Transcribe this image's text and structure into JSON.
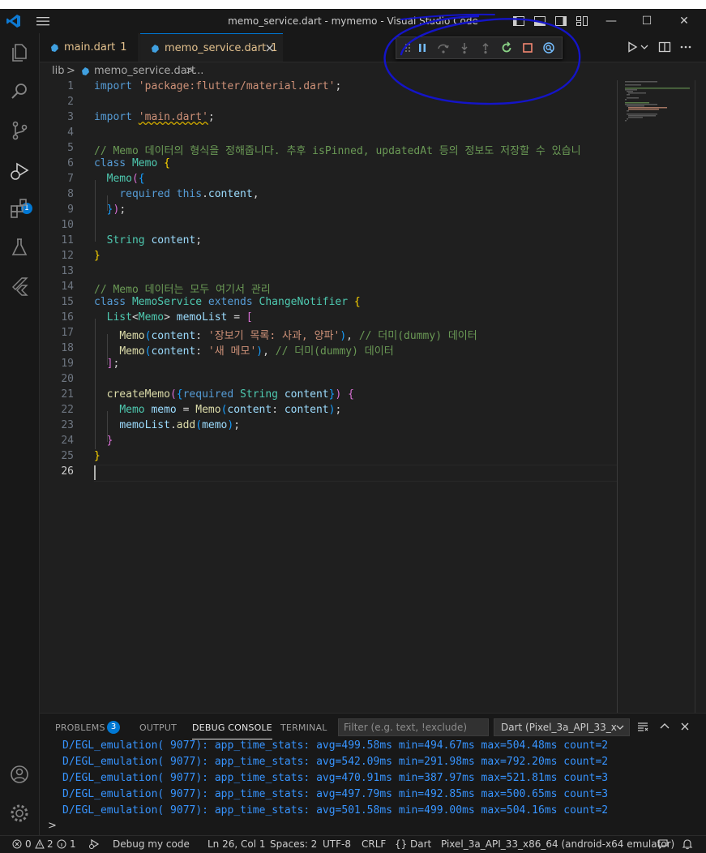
{
  "window": {
    "title": "memo_service.dart - mymemo - Visual Studio Code"
  },
  "tabs": [
    {
      "label": "main.dart",
      "problems": "1"
    },
    {
      "label": "memo_service.dart",
      "problems": "1",
      "close": "×"
    }
  ],
  "breadcrumb": {
    "folder": "lib",
    "sep1": ">",
    "file": "memo_service.dart",
    "sep2": ">",
    "more": "..."
  },
  "editor": {
    "line_numbers": [
      "1",
      "2",
      "3",
      "4",
      "5",
      "6",
      "7",
      "8",
      "9",
      "10",
      "11",
      "12",
      "13",
      "14",
      "15",
      "16",
      "17",
      "18",
      "19",
      "20",
      "21",
      "22",
      "23",
      "24",
      "25",
      "26"
    ],
    "current_line": 26,
    "lines": [
      "import 'package:flutter/material.dart';",
      "",
      "import 'main.dart';",
      "",
      "// Memo 데이터의 형식을 정해줍니다. 추후 isPinned, updatedAt 등의 정보도 저장할 수 있습니",
      "class Memo {",
      "  Memo({",
      "    required this.content,",
      "  });",
      "",
      "  String content;",
      "}",
      "",
      "// Memo 데이터는 모두 여기서 관리",
      "class MemoService extends ChangeNotifier {",
      "  List<Memo> memoList = [",
      "    Memo(content: '장보기 목록: 사과, 양파'), // 더미(dummy) 데이터",
      "    Memo(content: '새 메모'), // 더미(dummy) 데이터",
      "  ];",
      "",
      "  createMemo({required String content}) {",
      "    Memo memo = Memo(content: content);",
      "    memoList.add(memo);",
      "  }",
      "}",
      ""
    ]
  },
  "panel": {
    "tabs": [
      "PROBLEMS",
      "OUTPUT",
      "DEBUG CONSOLE",
      "TERMINAL"
    ],
    "problems_count": "3",
    "active_tab": "DEBUG CONSOLE",
    "filter_placeholder": "Filter (e.g. text, !exclude)",
    "session": "Dart (Pixel_3a_API_33_x",
    "console_lines": [
      "D/EGL_emulation( 9077): app_time_stats: avg=499.58ms min=494.67ms max=504.48ms count=2",
      "D/EGL_emulation( 9077): app_time_stats: avg=542.09ms min=291.98ms max=792.20ms count=2",
      "D/EGL_emulation( 9077): app_time_stats: avg=470.91ms min=387.97ms max=521.81ms count=3",
      "D/EGL_emulation( 9077): app_time_stats: avg=497.79ms min=492.85ms max=500.65ms count=3",
      "D/EGL_emulation( 9077): app_time_stats: avg=501.58ms min=499.00ms max=504.16ms count=2"
    ],
    "prompt": ">"
  },
  "activity_bar": {
    "run_badge": "1"
  },
  "status": {
    "errors": "0",
    "warnings": "2",
    "infos": "1",
    "debug_label": "Debug my code",
    "position": "Ln 26, Col 1",
    "spaces": "Spaces: 2",
    "encoding": "UTF-8",
    "eol": "CRLF",
    "language": "Dart",
    "device": "Pixel_3a_API_33_x86_64 (android-x64 emulator)"
  },
  "colors": {
    "accent": "#0078d4",
    "editor_bg": "#1f1f1f",
    "chrome_bg": "#181818",
    "annotation": "#1414c8"
  }
}
